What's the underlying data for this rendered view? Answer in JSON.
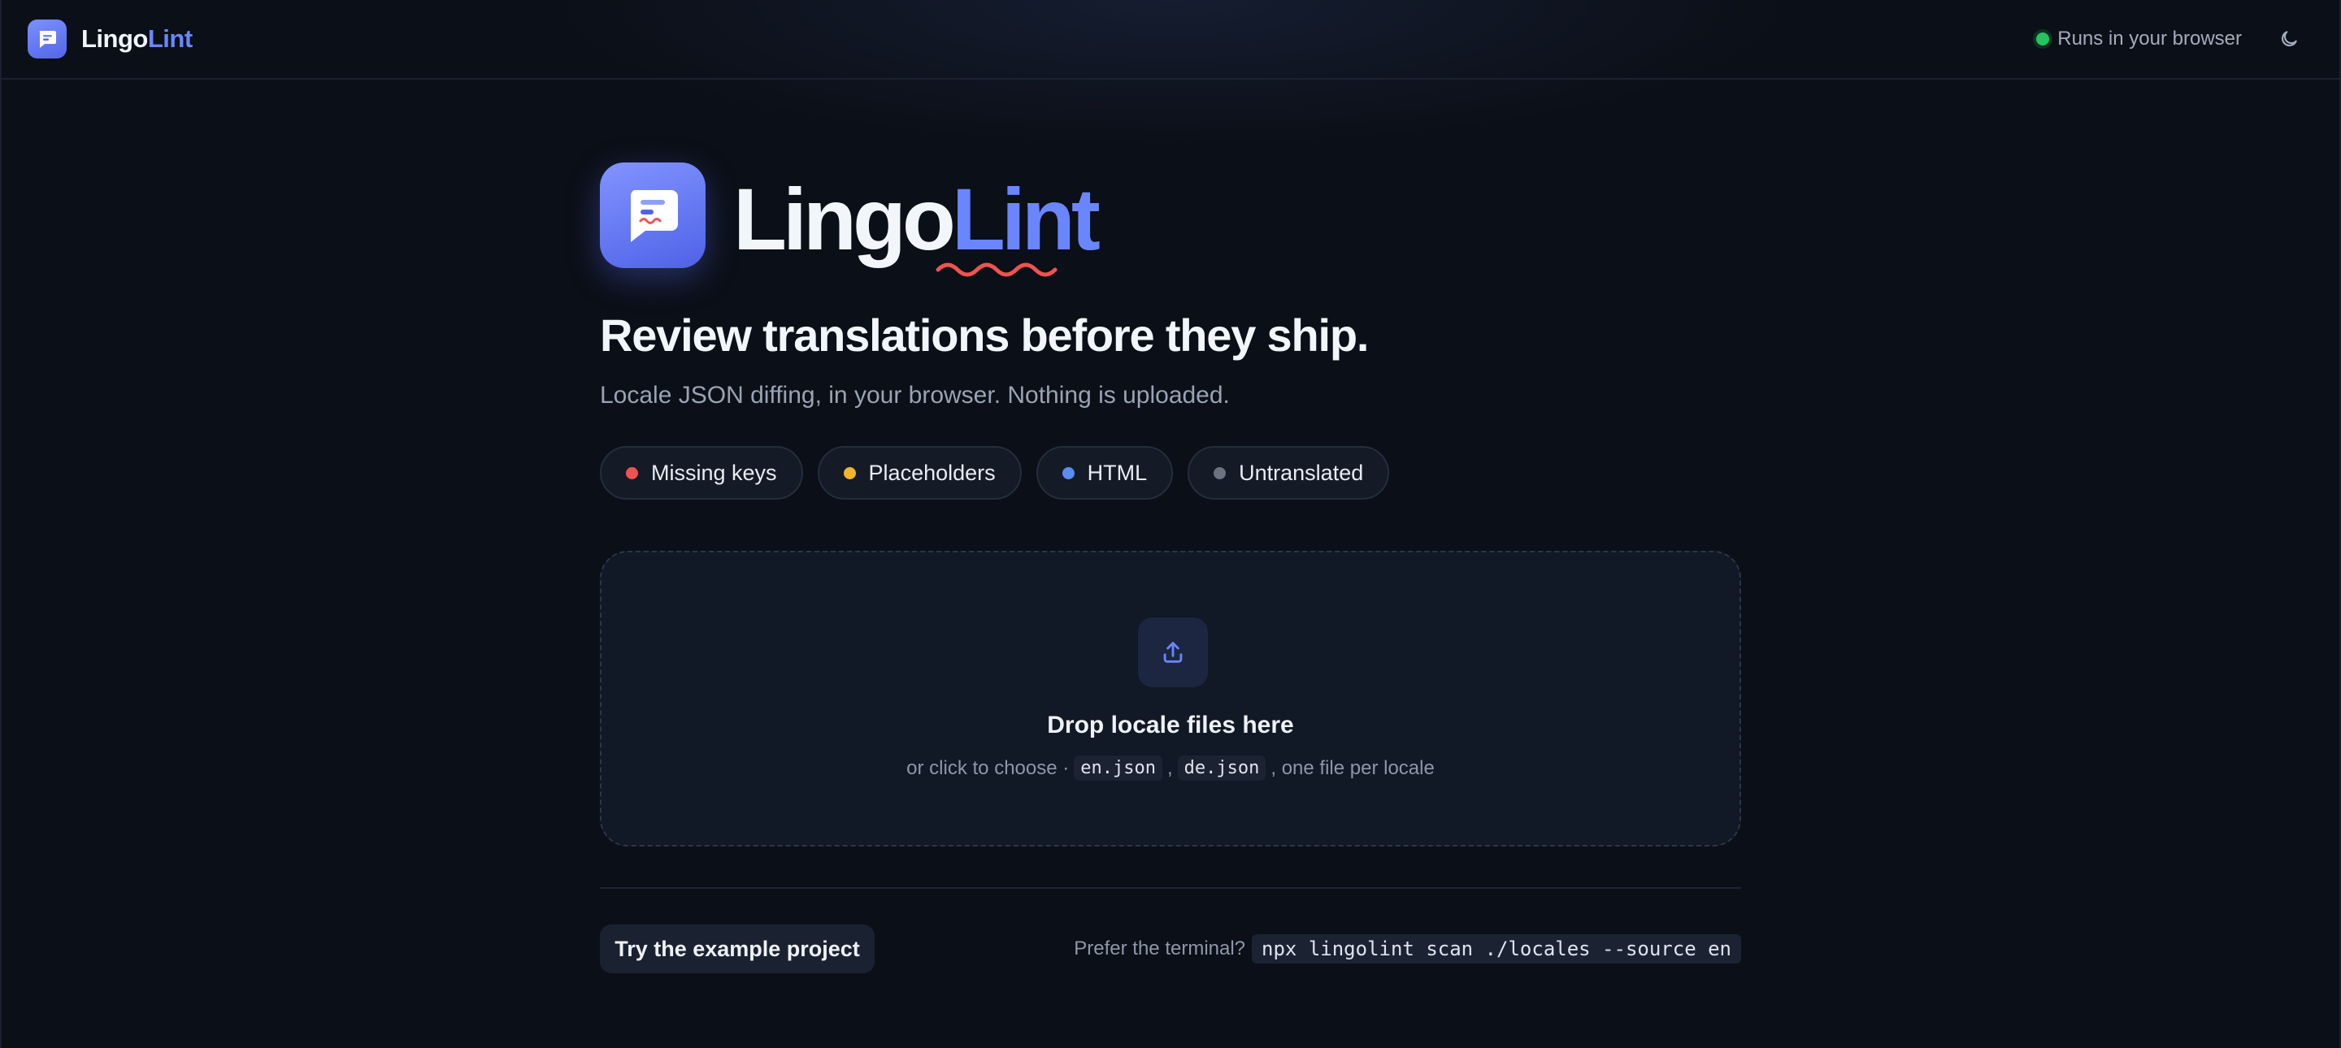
{
  "header": {
    "brand_prefix": "Lingo",
    "brand_accent": "Lint",
    "status_text": "Runs in your browser",
    "logo_icon": "chat-bubble-icon",
    "theme_icon": "moon-icon"
  },
  "hero": {
    "brand_prefix": "Lingo",
    "brand_accent": "Lint",
    "headline": "Review translations before they ship.",
    "subline": "Locale JSON diffing, in your browser. Nothing is uploaded."
  },
  "chips": [
    {
      "label": "Missing keys",
      "color": "#ef5350"
    },
    {
      "label": "Placeholders",
      "color": "#f0b429"
    },
    {
      "label": "HTML",
      "color": "#5b8def"
    },
    {
      "label": "Untranslated",
      "color": "#6b7280"
    }
  ],
  "dropzone": {
    "icon": "upload-icon",
    "title": "Drop locale files here",
    "hint_prefix": "or click to choose ·",
    "file_a": "en.json",
    "sep": ",",
    "file_b": "de.json",
    "hint_suffix": ", one file per locale"
  },
  "footer": {
    "example_button": "Try the example project",
    "terminal_label": "Prefer the terminal?",
    "terminal_command": "npx lingolint scan ./locales --source en"
  },
  "colors": {
    "accent": "#6a86ff",
    "background": "#0b0f17",
    "status_ok": "#22c55e",
    "squiggle": "#ef5350"
  }
}
